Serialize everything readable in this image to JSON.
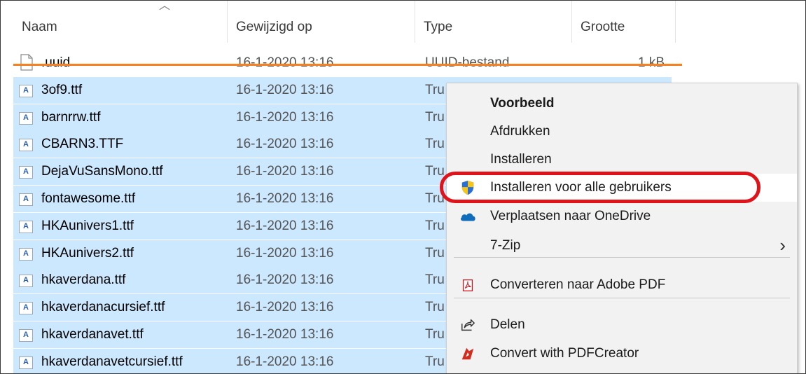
{
  "header": {
    "columns": [
      {
        "label": "Naam"
      },
      {
        "label": "Gewijzigd op"
      },
      {
        "label": "Type"
      },
      {
        "label": "Grootte"
      }
    ]
  },
  "files": [
    {
      "name": ".uuid",
      "date": "16-1-2020 13:16",
      "type": "UUID-bestand",
      "size": "1 kB",
      "icon": "document-icon"
    },
    {
      "name": "3of9.ttf",
      "date": "16-1-2020 13:16",
      "type": "Tru",
      "size": "",
      "icon": "font-icon"
    },
    {
      "name": "barnrrw.ttf",
      "date": "16-1-2020 13:16",
      "type": "Tru",
      "size": "",
      "icon": "font-icon"
    },
    {
      "name": "CBARN3.TTF",
      "date": "16-1-2020 13:16",
      "type": "Tru",
      "size": "",
      "icon": "font-icon"
    },
    {
      "name": "DejaVuSansMono.ttf",
      "date": "16-1-2020 13:16",
      "type": "Tru",
      "size": "",
      "icon": "font-icon"
    },
    {
      "name": "fontawesome.ttf",
      "date": "16-1-2020 13:16",
      "type": "Tru",
      "size": "",
      "icon": "font-icon"
    },
    {
      "name": "HKAunivers1.ttf",
      "date": "16-1-2020 13:16",
      "type": "Tru",
      "size": "",
      "icon": "font-icon"
    },
    {
      "name": "HKAunivers2.ttf",
      "date": "16-1-2020 13:16",
      "type": "Tru",
      "size": "",
      "icon": "font-icon"
    },
    {
      "name": "hkaverdana.ttf",
      "date": "16-1-2020 13:16",
      "type": "Tru",
      "size": "",
      "icon": "font-icon"
    },
    {
      "name": "hkaverdanacursief.ttf",
      "date": "16-1-2020 13:16",
      "type": "Tru",
      "size": "",
      "icon": "font-icon"
    },
    {
      "name": "hkaverdanavet.ttf",
      "date": "16-1-2020 13:16",
      "type": "Tru",
      "size": "",
      "icon": "font-icon"
    },
    {
      "name": "hkaverdanavetcursief.ttf",
      "date": "16-1-2020 13:16",
      "type": "Tru",
      "size": "",
      "icon": "font-icon"
    }
  ],
  "font_icon_glyph": "A",
  "context_menu": {
    "items": [
      {
        "label": "Voorbeeld",
        "bold": true,
        "icon": ""
      },
      {
        "label": "Afdrukken",
        "icon": ""
      },
      {
        "label": "Installeren",
        "icon": ""
      },
      {
        "label": "Installeren voor alle gebruikers",
        "icon": "uac-shield-icon",
        "highlighted": true
      },
      {
        "label": "Verplaatsen naar OneDrive",
        "icon": "onedrive-cloud-icon"
      },
      {
        "label": "7-Zip",
        "icon": "",
        "submenu": true
      },
      {
        "label": "Converteren naar Adobe PDF",
        "icon": "adobe-pdf-icon"
      },
      {
        "label": "Delen",
        "icon": "share-icon"
      },
      {
        "label": "Convert with PDFCreator",
        "icon": "pdfcreator-icon"
      }
    ],
    "submenu_glyph": "›"
  },
  "colors": {
    "selection": "#cce8ff",
    "strike_line": "#f58220",
    "annotation_circle": "#e0131a",
    "menu_bg": "#f2f2f2"
  }
}
